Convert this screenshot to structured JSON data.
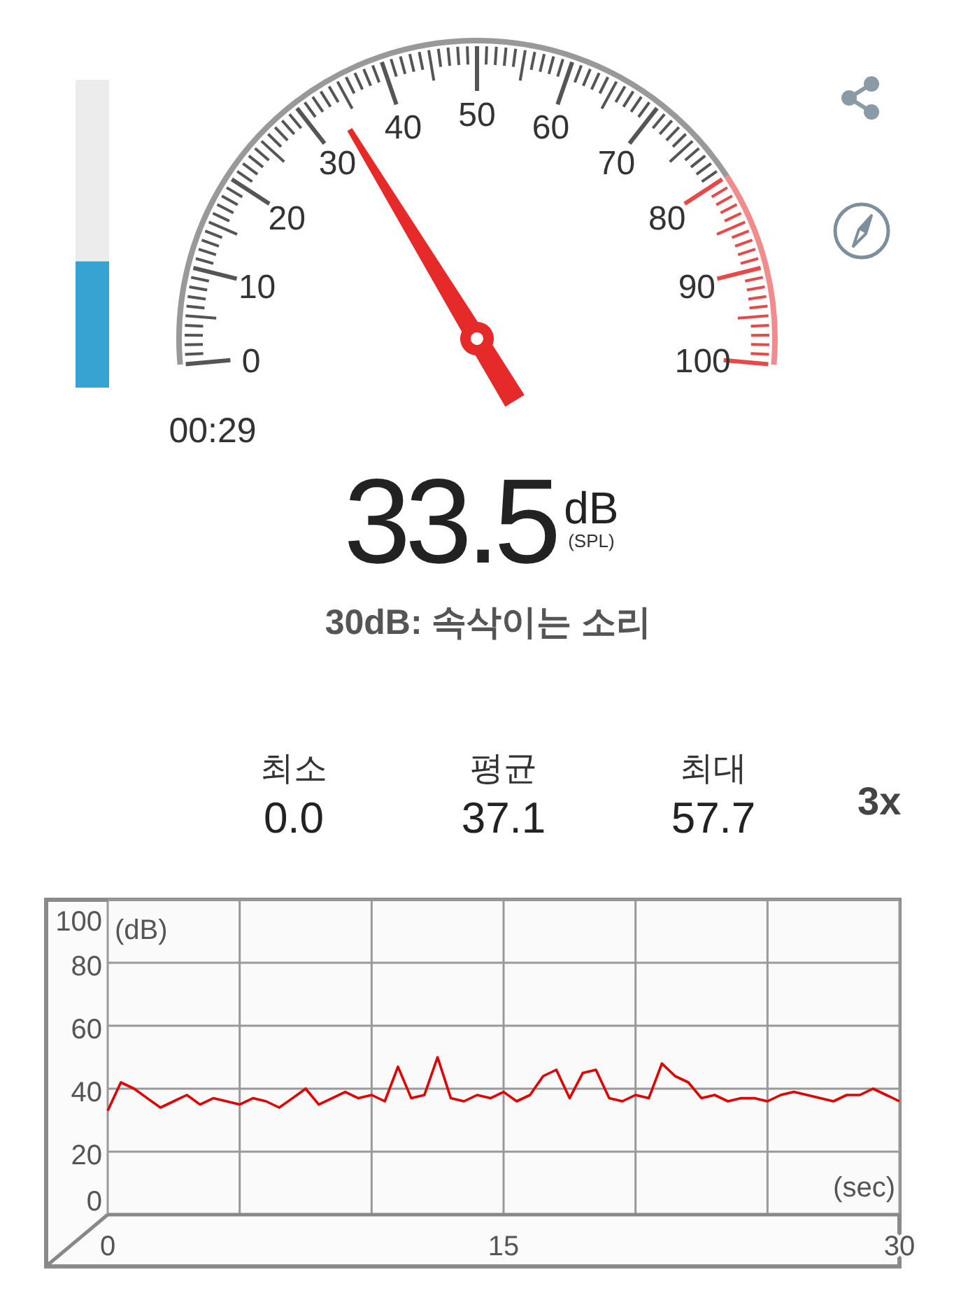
{
  "level_meter": {
    "level": 0.41
  },
  "gauge": {
    "scale_labels": [
      "0",
      "10",
      "20",
      "30",
      "40",
      "50",
      "60",
      "70",
      "80",
      "90",
      "100"
    ],
    "elapsed": "00:29"
  },
  "actions": [
    {
      "kind": "share"
    },
    {
      "kind": "compass"
    }
  ],
  "reading": {
    "value": "33.5",
    "unit": "dB",
    "unit_note": "(SPL)",
    "description": "30dB: 속삭이는 소리"
  },
  "stats": [
    {
      "label": "최소",
      "value": "0.0"
    },
    {
      "label": "평균",
      "value": "37.1"
    },
    {
      "label": "최대",
      "value": "57.7"
    }
  ],
  "speed": "3x",
  "chart": {
    "chart_data": {
      "type": "line",
      "grid": true,
      "xlabel": "(sec)",
      "ylabel": "(dB)",
      "xlim": [
        0,
        30
      ],
      "ylim": [
        0,
        100
      ],
      "xticks": [
        0,
        15,
        30
      ],
      "yticks": [
        0,
        20,
        40,
        60,
        80,
        100
      ],
      "x": [
        0,
        0.5,
        1,
        1.5,
        2,
        2.5,
        3,
        3.5,
        4,
        4.5,
        5,
        5.5,
        6,
        6.5,
        7,
        7.5,
        8,
        8.5,
        9,
        9.5,
        10,
        10.5,
        11,
        11.5,
        12,
        12.5,
        13,
        13.5,
        14,
        14.5,
        15,
        15.5,
        16,
        16.5,
        17,
        17.5,
        18,
        18.5,
        19,
        19.5,
        20,
        20.5,
        21,
        21.5,
        22,
        22.5,
        23,
        23.5,
        24,
        24.5,
        25,
        25.5,
        26,
        26.5,
        27,
        27.5,
        28,
        28.5,
        29,
        29.5,
        30
      ],
      "series": [
        {
          "color": "#e00000",
          "values": [
            33,
            42,
            40,
            37,
            34,
            36,
            38,
            35,
            37,
            36,
            35,
            37,
            36,
            34,
            37,
            40,
            35,
            37,
            39,
            37,
            38,
            36,
            47,
            37,
            38,
            50,
            37,
            36,
            38,
            37,
            39,
            36,
            38,
            44,
            46,
            37,
            45,
            46,
            37,
            36,
            38,
            37,
            48,
            44,
            42,
            37,
            38,
            36,
            37,
            37,
            36,
            38,
            39,
            38,
            37,
            36,
            38,
            38,
            40,
            38,
            36
          ]
        }
      ]
    }
  }
}
